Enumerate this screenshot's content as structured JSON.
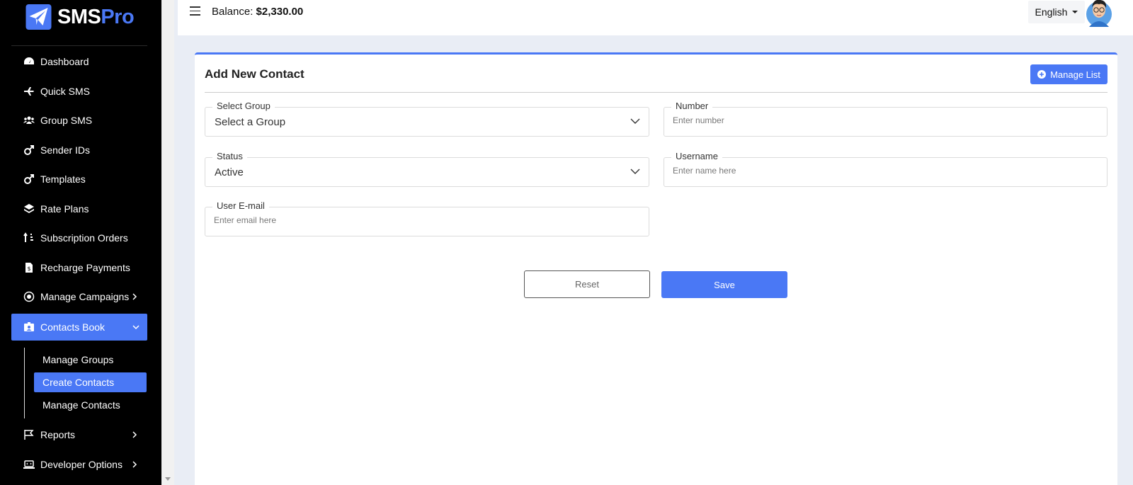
{
  "brand": {
    "name_part1": "SMS",
    "name_part2": "Pro",
    "logo_icon": "paper-plane-icon"
  },
  "sidebar": {
    "items": [
      {
        "label": "Dashboard",
        "icon": "gauge-icon"
      },
      {
        "label": "Quick SMS",
        "icon": "plane-icon"
      },
      {
        "label": "Group SMS",
        "icon": "users-icon"
      },
      {
        "label": "Sender IDs",
        "icon": "mars-icon"
      },
      {
        "label": "Templates",
        "icon": "mars-icon"
      },
      {
        "label": "Rate Plans",
        "icon": "layers-icon"
      },
      {
        "label": "Subscription Orders",
        "icon": "sort-icon"
      },
      {
        "label": "Recharge Payments",
        "icon": "invoice-icon"
      },
      {
        "label": "Manage Campaigns",
        "icon": "campaign-icon"
      },
      {
        "label": "Contacts Book",
        "icon": "contact-card-icon"
      },
      {
        "label": "Reports",
        "icon": "flag-icon"
      },
      {
        "label": "Developer Options",
        "icon": "laptop-code-icon"
      }
    ],
    "contacts_sub": [
      {
        "label": "Manage Groups"
      },
      {
        "label": "Create Contacts"
      },
      {
        "label": "Manage Contacts"
      }
    ]
  },
  "topbar": {
    "balance_label": "Balance:",
    "balance_value": "$2,330.00",
    "language": "English"
  },
  "card": {
    "title": "Add New Contact",
    "manage_list_label": "Manage List",
    "fields": {
      "group": {
        "label": "Select Group",
        "value": "Select a Group"
      },
      "number": {
        "label": "Number",
        "placeholder": "Enter number"
      },
      "status": {
        "label": "Status",
        "value": "Active"
      },
      "username": {
        "label": "Username",
        "placeholder": "Enter name here"
      },
      "email": {
        "label": "User E-mail",
        "placeholder": "Enter email here"
      }
    },
    "reset_label": "Reset",
    "save_label": "Save"
  },
  "colors": {
    "accent": "#4a78f5",
    "sidebar_bg": "#000000",
    "page_bg": "#e9edf5"
  }
}
